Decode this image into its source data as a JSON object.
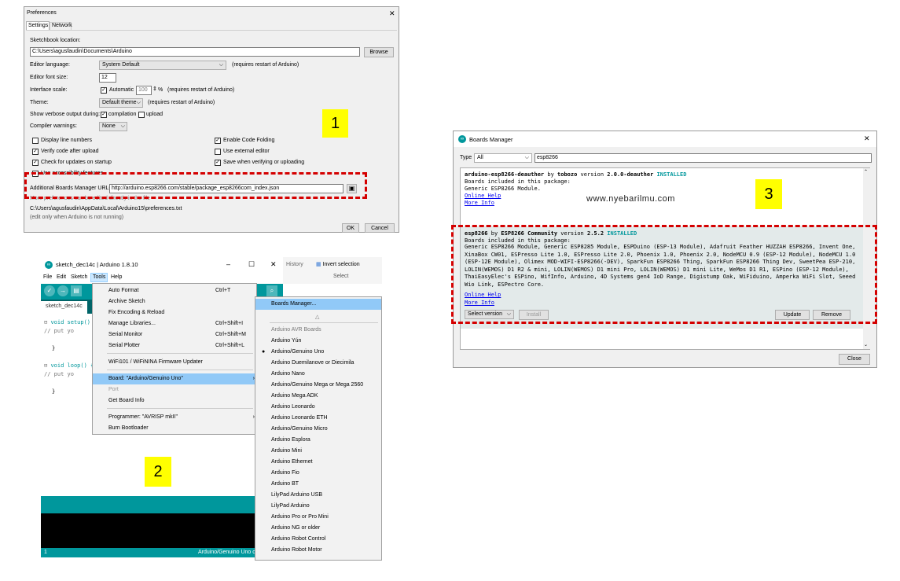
{
  "pref": {
    "title": "Preferences",
    "tabs": [
      "Settings",
      "Network"
    ],
    "sketchbook_label": "Sketchbook location:",
    "sketchbook_value": "C:\\Users\\agusfaudin\\Documents\\Arduino",
    "browse": "Browse",
    "lang_label": "Editor language:",
    "lang_value": "System Default",
    "lang_note": "(requires restart of Arduino)",
    "font_label": "Editor font size:",
    "font_value": "12",
    "scale_label": "Interface scale:",
    "scale_auto": "Automatic",
    "scale_value": "100",
    "scale_pct": "%",
    "scale_note": "(requires restart of Arduino)",
    "theme_label": "Theme:",
    "theme_value": "Default theme",
    "theme_note": "(requires restart of Arduino)",
    "verbose_label": "Show verbose output during:",
    "verbose_compilation": "compilation",
    "verbose_upload": "upload",
    "warnings_label": "Compiler warnings:",
    "warnings_value": "None",
    "opt_line_numbers": "Display line numbers",
    "opt_code_folding": "Enable Code Folding",
    "opt_verify": "Verify code after upload",
    "opt_external": "Use external editor",
    "opt_updates": "Check for updates on startup",
    "opt_save": "Save when verifying or uploading",
    "opt_accessibility": "Use accessibility features",
    "urls_label": "Additional Boards Manager URLs:",
    "urls_value": "http://arduino.esp8266.com/stable/package_esp8266com_index.json",
    "more_note": "More preferences can be edited directly in the file",
    "file_path": "C:\\Users\\agusfaudin\\AppData\\Local\\Arduino15\\preferences.txt",
    "edit_note": "(edit only when Arduino is not running)",
    "ok": "OK",
    "cancel": "Cancel",
    "close_glyph": "✕"
  },
  "ide": {
    "title": "sketch_dec14c | Arduino 1.8.10",
    "menubar": [
      "File",
      "Edit",
      "Sketch",
      "Tools",
      "Help"
    ],
    "tab": "sketch_dec14c",
    "code": [
      "void setup() {",
      "  // put yo",
      "",
      "}",
      "",
      "void loop() {",
      "  // put yo",
      "",
      "}"
    ],
    "status_line": "1",
    "status_board": "Arduino/Genuino Uno o",
    "bg_history": "History",
    "bg_invert": "Invert selection",
    "bg_select": "Select",
    "win_min": "–",
    "win_max": "☐",
    "win_close": "✕"
  },
  "tools_menu": [
    {
      "label": "Auto Format",
      "shortcut": "Ctrl+T"
    },
    {
      "label": "Archive Sketch",
      "shortcut": ""
    },
    {
      "label": "Fix Encoding & Reload",
      "shortcut": ""
    },
    {
      "label": "Manage Libraries...",
      "shortcut": "Ctrl+Shift+I"
    },
    {
      "label": "Serial Monitor",
      "shortcut": "Ctrl+Shift+M"
    },
    {
      "label": "Serial Plotter",
      "shortcut": "Ctrl+Shift+L"
    },
    {
      "label": "WiFi101 / WiFiNINA Firmware Updater",
      "shortcut": ""
    },
    {
      "label": "Board: \"Arduino/Genuino Uno\"",
      "shortcut": ""
    },
    {
      "label": "Port",
      "shortcut": ""
    },
    {
      "label": "Get Board Info",
      "shortcut": ""
    },
    {
      "label": "Programmer: \"AVRISP mkII\"",
      "shortcut": ""
    },
    {
      "label": "Burn Bootloader",
      "shortcut": ""
    }
  ],
  "board_menu": {
    "manager": "Boards Manager...",
    "triangle": "△",
    "section": "Arduino AVR Boards",
    "items": [
      "Arduino Yún",
      "Arduino/Genuino Uno",
      "Arduino Duemilanove or Diecimila",
      "Arduino Nano",
      "Arduino/Genuino Mega or Mega 2560",
      "Arduino Mega ADK",
      "Arduino Leonardo",
      "Arduino Leonardo ETH",
      "Arduino/Genuino Micro",
      "Arduino Esplora",
      "Arduino Mini",
      "Arduino Ethernet",
      "Arduino Fio",
      "Arduino BT",
      "LilyPad Arduino USB",
      "LilyPad Arduino",
      "Arduino Pro or Pro Mini",
      "Arduino NG or older",
      "Arduino Robot Control",
      "Arduino Robot Motor"
    ]
  },
  "bm": {
    "title": "Boards Manager",
    "type_label": "Type",
    "type_value": "All",
    "search_value": "esp8266",
    "e1_name": "arduino-esp8266-deauther",
    "e1_by": "by",
    "e1_author": "tobozo",
    "e1_version_word": "version",
    "e1_version": "2.0.0-deauther",
    "e1_installed": "INSTALLED",
    "e1_included": "Boards included in this package:",
    "e1_boards": "Generic ESP8266 Module.",
    "e1_help": "Online Help",
    "e1_info": "More Info",
    "e2_name": "esp8266",
    "e2_by": "by",
    "e2_author": "ESP8266 Community",
    "e2_version_word": "version",
    "e2_version": "2.5.2",
    "e2_installed": "INSTALLED",
    "e2_included": "Boards included in this package:",
    "e2_boards": "Generic ESP8266 Module, Generic ESP8285 Module, ESPDuino (ESP-13 Module), Adafruit Feather HUZZAH ESP8266, Invent One, XinaBox CW01, ESPresso Lite 1.0, ESPresso Lite 2.0, Phoenix 1.0, Phoenix 2.0, NodeMCU 0.9 (ESP-12 Module), NodeMCU 1.0 (ESP-12E Module), Olimex MOD-WIFI-ESP8266(-DEV), SparkFun ESP8266 Thing, SparkFun ESP8266 Thing Dev, SweetPea ESP-210, LOLIN(WEMOS) D1 R2 & mini, LOLIN(WEMOS) D1 mini Pro, LOLIN(WEMOS) D1 mini Lite, WeMos D1 R1, ESPino (ESP-12 Module), ThaiEasyElec's ESPino, WifInfo, Arduino, 4D Systems gen4 IoD Range, Digistump Oak, WiFiduino, Amperka WiFi Slot, Seeed Wio Link, ESPectro Core.",
    "e2_help": "Online Help",
    "e2_info": "More Info",
    "select_version": "Select version",
    "install": "Install",
    "update": "Update",
    "remove": "Remove",
    "close": "Close",
    "watermark": "www.nyebarilmu.com",
    "close_glyph": "✕",
    "logo": "∞"
  },
  "markers": [
    "1",
    "2",
    "3"
  ],
  "colors": {
    "dash": "#d40000",
    "marker": "#ffff00",
    "arduino_teal": "#00979c",
    "installed": "#00979c",
    "menu_highlight": "#91c9f7"
  }
}
